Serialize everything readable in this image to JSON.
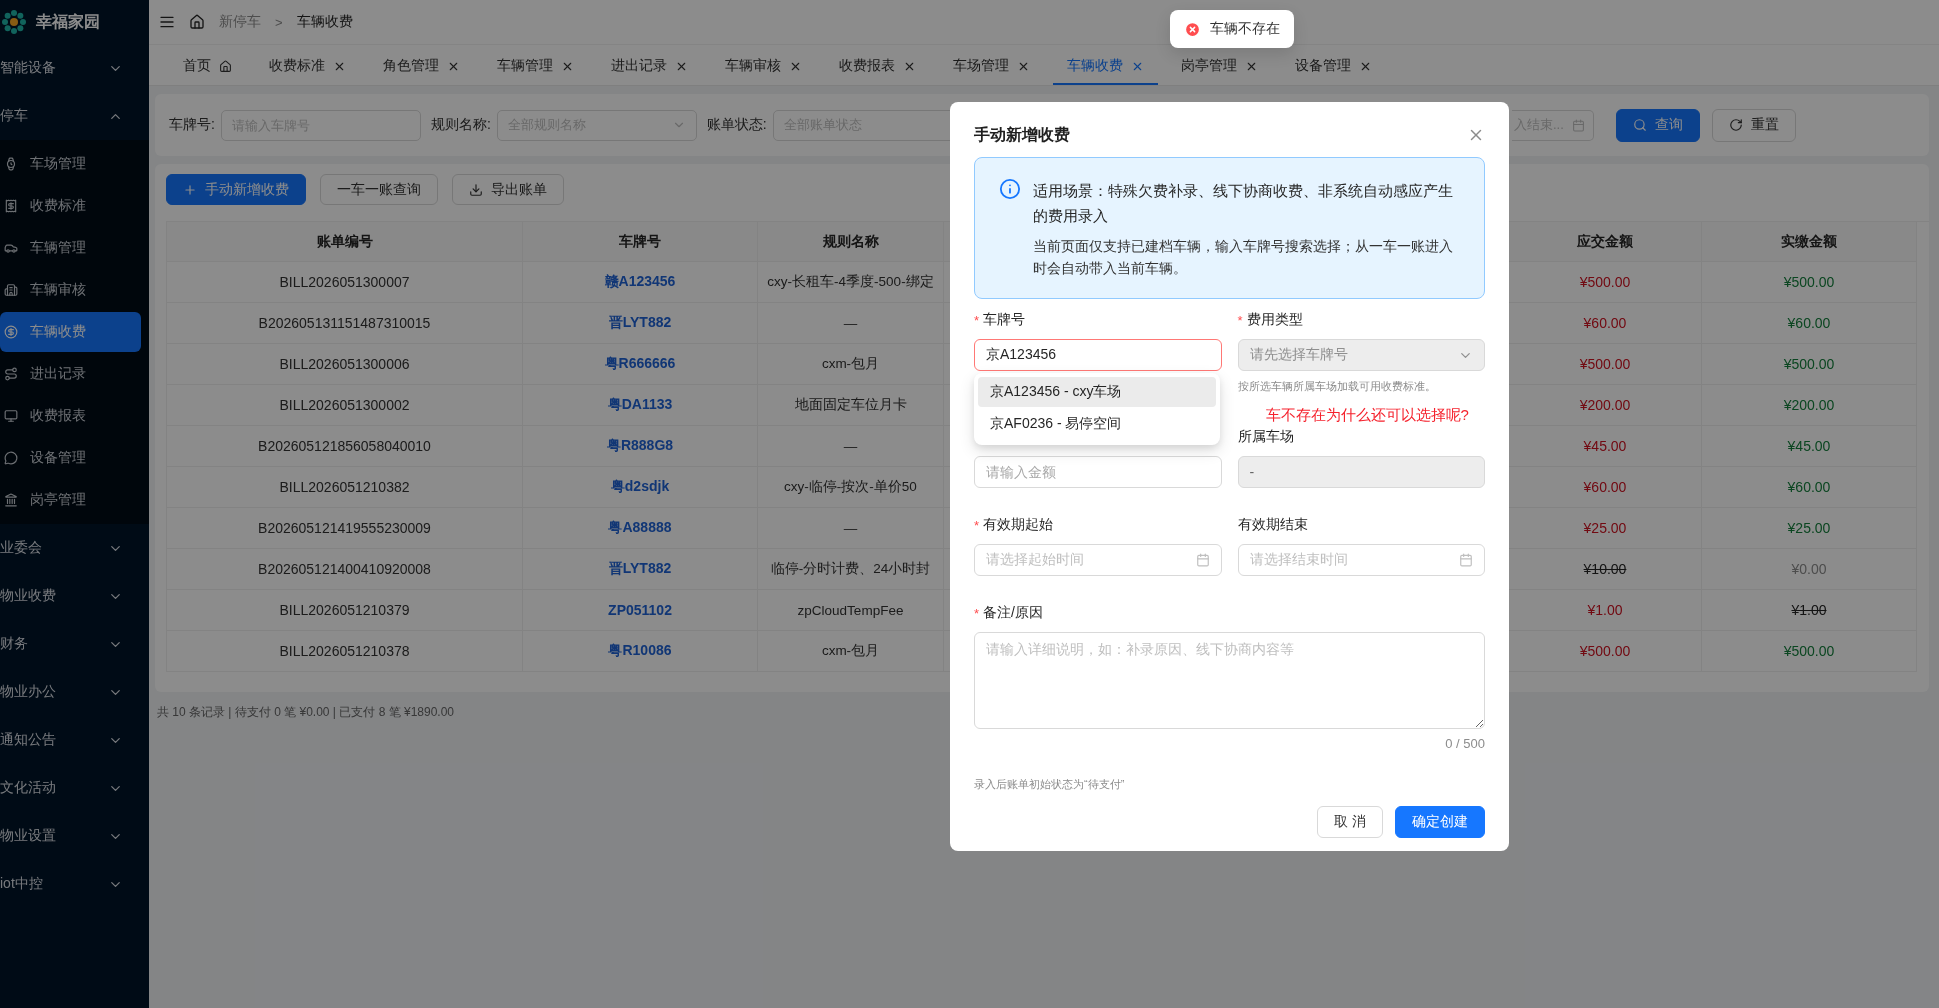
{
  "sidebar": {
    "logo": "幸福家园",
    "groups": [
      {
        "label": "智能设备",
        "expanded": false
      },
      {
        "label": "停车",
        "expanded": true,
        "children": [
          {
            "label": "车场管理",
            "selected": false
          },
          {
            "label": "收费标准",
            "selected": false
          },
          {
            "label": "车辆管理",
            "selected": false
          },
          {
            "label": "车辆审核",
            "selected": false
          },
          {
            "label": "车辆收费",
            "selected": true
          },
          {
            "label": "进出记录",
            "selected": false
          },
          {
            "label": "收费报表",
            "selected": false
          },
          {
            "label": "设备管理",
            "selected": false
          },
          {
            "label": "岗亭管理",
            "selected": false
          }
        ]
      },
      {
        "label": "业委会",
        "expanded": false
      },
      {
        "label": "物业收费",
        "expanded": false
      },
      {
        "label": "财务",
        "expanded": false
      },
      {
        "label": "物业办公",
        "expanded": false
      },
      {
        "label": "通知公告",
        "expanded": false
      },
      {
        "label": "文化活动",
        "expanded": false
      },
      {
        "label": "物业设置",
        "expanded": false
      },
      {
        "label": "iot中控",
        "expanded": false
      }
    ]
  },
  "breadcrumb": {
    "separator": ">",
    "items": [
      "新停车",
      "车辆收费"
    ]
  },
  "tabs": [
    {
      "label": "首页",
      "kind": "home",
      "selected": false
    },
    {
      "label": "收费标准",
      "kind": "page",
      "selected": false
    },
    {
      "label": "角色管理",
      "kind": "page",
      "selected": false
    },
    {
      "label": "车辆管理",
      "kind": "page",
      "selected": false
    },
    {
      "label": "进出记录",
      "kind": "page",
      "selected": false
    },
    {
      "label": "车辆审核",
      "kind": "page",
      "selected": false
    },
    {
      "label": "收费报表",
      "kind": "page",
      "selected": false
    },
    {
      "label": "车场管理",
      "kind": "page",
      "selected": false
    },
    {
      "label": "车辆收费",
      "kind": "page",
      "selected": true
    },
    {
      "label": "岗亭管理",
      "kind": "page",
      "selected": false
    },
    {
      "label": "设备管理",
      "kind": "page",
      "selected": false
    }
  ],
  "toast": {
    "kind": "error",
    "text": "车辆不存在"
  },
  "filters": [
    {
      "label": "车牌号:",
      "kind": "input",
      "placeholder": "请输入车牌号"
    },
    {
      "label": "规则名称:",
      "kind": "select",
      "placeholder": "全部规则名称"
    },
    {
      "label": "账单状态:",
      "kind": "select",
      "placeholder": "全部账单状态"
    }
  ],
  "end_date": {
    "placeholder": "入结束..."
  },
  "filter_buttons": [
    {
      "label": "查询",
      "kind": "primary"
    },
    {
      "label": "重置",
      "kind": "default"
    }
  ],
  "toolbar": [
    {
      "label": "手动新增收费",
      "kind": "add"
    },
    {
      "label": "一车一账查询",
      "kind": "default"
    },
    {
      "label": "导出账单",
      "kind": "export"
    }
  ],
  "table": {
    "columns": [
      "账单编号",
      "车牌号",
      "规则名称",
      "应交金额",
      "实缴金额"
    ],
    "rows": [
      {
        "bill_no": "BILL2026051300007",
        "plate": "赣A123456",
        "rule": "cxy-长租车-4季度-500-绑定",
        "due": {
          "text": "¥500.00",
          "kind": "due"
        },
        "paid": {
          "text": "¥500.00",
          "kind": "paid"
        }
      },
      {
        "bill_no": "B202605131151487310015",
        "plate": "晋LYT882",
        "rule": "—",
        "due": {
          "text": "¥60.00",
          "kind": "due"
        },
        "paid": {
          "text": "¥60.00",
          "kind": "paid"
        }
      },
      {
        "bill_no": "BILL2026051300006",
        "plate": "粤R666666",
        "rule": "cxm-包月",
        "due": {
          "text": "¥500.00",
          "kind": "due"
        },
        "paid": {
          "text": "¥500.00",
          "kind": "paid"
        }
      },
      {
        "bill_no": "BILL2026051300002",
        "plate": "粤DA1133",
        "rule": "地面固定车位月卡",
        "due": {
          "text": "¥200.00",
          "kind": "due"
        },
        "paid": {
          "text": "¥200.00",
          "kind": "paid"
        }
      },
      {
        "bill_no": "B202605121856058040010",
        "plate": "粤R888G8",
        "rule": "—",
        "due": {
          "text": "¥45.00",
          "kind": "due"
        },
        "paid": {
          "text": "¥45.00",
          "kind": "paid"
        }
      },
      {
        "bill_no": "BILL2026051210382",
        "plate": "粤d2sdjk",
        "rule": "cxy-临停-按次-单价50",
        "due": {
          "text": "¥60.00",
          "kind": "due"
        },
        "paid": {
          "text": "¥60.00",
          "kind": "paid"
        }
      },
      {
        "bill_no": "B202605121419555230009",
        "plate": "粤A88888",
        "rule": "—",
        "due": {
          "text": "¥25.00",
          "kind": "due"
        },
        "paid": {
          "text": "¥25.00",
          "kind": "paid"
        }
      },
      {
        "bill_no": "B202605121400410920008",
        "plate": "晋LYT882",
        "rule": "临停-分时计费、24小时封",
        "due": {
          "text": "¥10.00",
          "kind": "void"
        },
        "paid": {
          "text": "¥0.00",
          "kind": "muted"
        }
      },
      {
        "bill_no": "BILL2026051210379",
        "plate": "ZP051102",
        "rule": "zpCloudTempFee",
        "due": {
          "text": "¥1.00",
          "kind": "due"
        },
        "paid": {
          "text": "¥1.00",
          "kind": "void"
        }
      },
      {
        "bill_no": "BILL2026051210378",
        "plate": "粤R10086",
        "rule": "cxm-包月",
        "due": {
          "text": "¥500.00",
          "kind": "due"
        },
        "paid": {
          "text": "¥500.00",
          "kind": "paid"
        }
      }
    ]
  },
  "summary": "共 10 条记录 | 待支付 0 笔 ¥0.00 | 已支付 8 笔 ¥1890.00",
  "modal": {
    "title": "手动新增收费",
    "required_mark": "*",
    "notice": {
      "title": "适用场景：特殊欠费补录、线下协商收费、非系统自动感应产生的费用录入",
      "detail": "当前页面仅支持已建档车辆，输入车牌号搜索选择；从一车一账进入时会自动带入当前车辆。"
    },
    "fields": [
      {
        "label": "车牌号",
        "required": true,
        "kind": "text",
        "value": "京A123456",
        "error": true
      },
      {
        "label": "费用类型",
        "required": true,
        "kind": "select",
        "placeholder": "请先选择车牌号",
        "disabled": true,
        "hint": "按所选车辆所属车场加载可用收费标准。"
      },
      {
        "label": "所属车场",
        "kind": "text",
        "value": "-",
        "disabled": true
      },
      {
        "label": "有效期起始",
        "required": true,
        "kind": "date",
        "placeholder": "请选择起始时间"
      },
      {
        "label": "有效期结束",
        "kind": "date",
        "placeholder": "请选择结束时间"
      }
    ],
    "annotation": "车不存在为什么还可以选择呢?",
    "amount_field": {
      "placeholder": "请输入金额"
    },
    "suggestions": [
      {
        "text": "京A123456 - cxy车场",
        "selected": true
      },
      {
        "text": "京AF0236 - 易停空间",
        "selected": false
      }
    ],
    "remark": {
      "label": "备注/原因",
      "required": true,
      "placeholder": "请输入详细说明，如：补录原因、线下协商内容等",
      "counter": "0 / 500"
    },
    "footnote": "录入后账单初始状态为“待支付”",
    "buttons": [
      {
        "label": "取 消",
        "kind": "default"
      },
      {
        "label": "确定创建",
        "kind": "primary"
      }
    ]
  }
}
